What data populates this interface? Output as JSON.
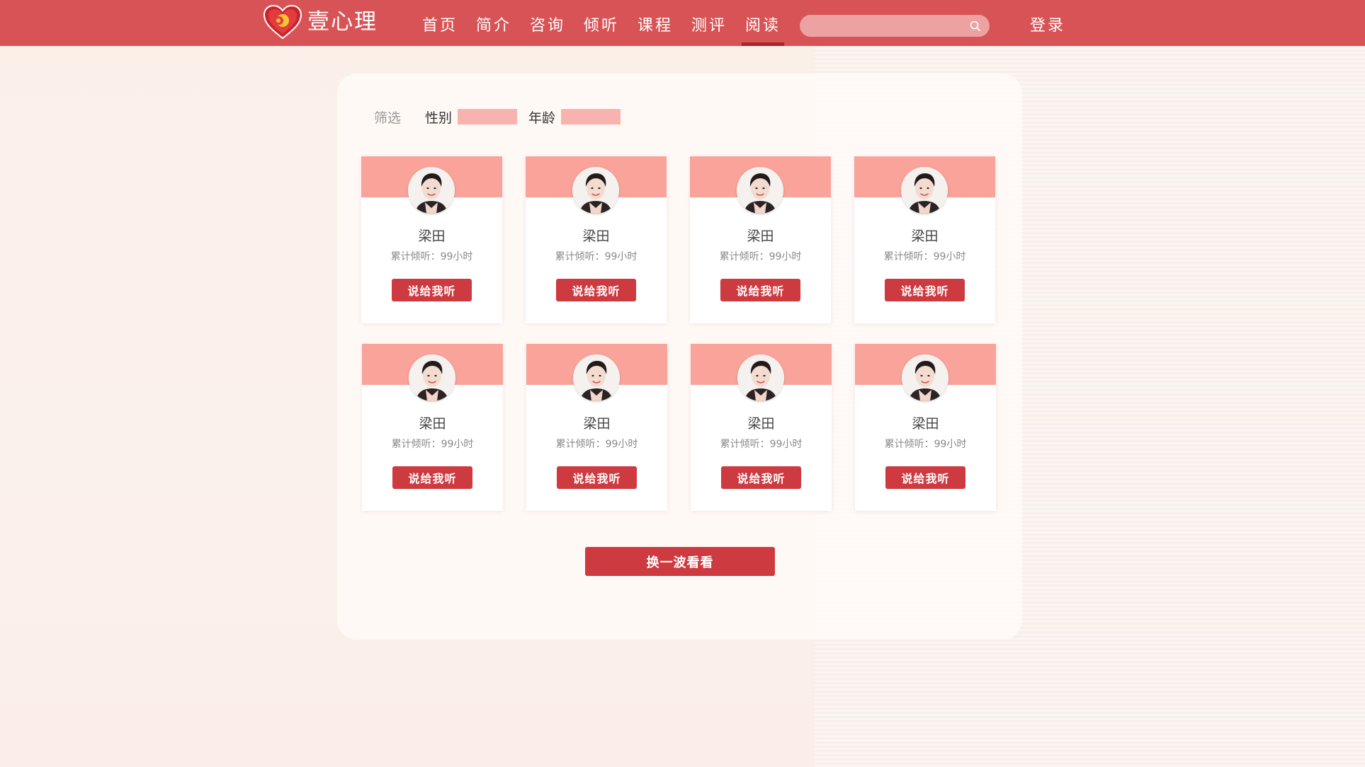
{
  "header": {
    "brand": "壹心理",
    "nav": [
      "首页",
      "简介",
      "咨询",
      "倾听",
      "课程",
      "测评",
      "阅读"
    ],
    "active_nav": "阅读",
    "search_placeholder": "",
    "login": "登录"
  },
  "filter": {
    "title": "筛选",
    "gender_label": "性别",
    "age_label": "年龄"
  },
  "cards": [
    {
      "name": "梁田",
      "hours": "累计倾听：99小时",
      "button": "说给我听"
    },
    {
      "name": "梁田",
      "hours": "累计倾听：99小时",
      "button": "说给我听"
    },
    {
      "name": "梁田",
      "hours": "累计倾听：99小时",
      "button": "说给我听"
    },
    {
      "name": "梁田",
      "hours": "累计倾听：99小时",
      "button": "说给我听"
    },
    {
      "name": "梁田",
      "hours": "累计倾听：99小时",
      "button": "说给我听"
    },
    {
      "name": "梁田",
      "hours": "累计倾听：99小时",
      "button": "说给我听"
    },
    {
      "name": "梁田",
      "hours": "累计倾听：99小时",
      "button": "说给我听"
    },
    {
      "name": "梁田",
      "hours": "累计倾听：99小时",
      "button": "说给我听"
    }
  ],
  "refresh_button": "换一波看看",
  "colors": {
    "header": "#d75356",
    "accent": "#cd3a40",
    "card_top": "#f9a39a",
    "filter_box": "#f9b3ae"
  }
}
